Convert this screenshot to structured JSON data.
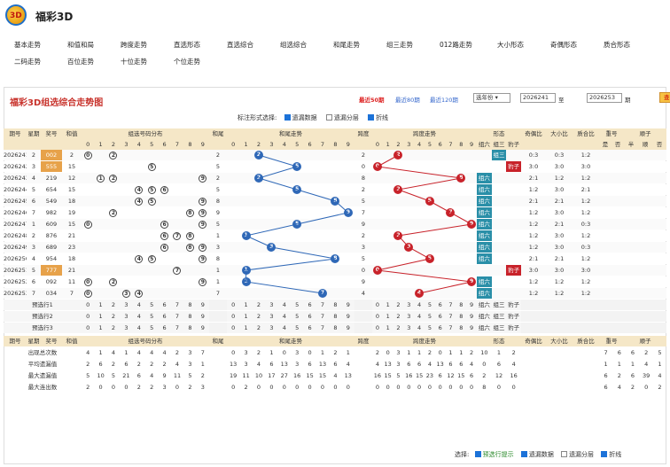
{
  "app": {
    "title": "福彩3D",
    "logo_text": "3D"
  },
  "nav": [
    {
      "label": "基本走势"
    },
    {
      "label": "和值和局"
    },
    {
      "label": "跨度走势"
    },
    {
      "label": "直选形态"
    },
    {
      "label": "直选综合"
    },
    {
      "label": "组选综合"
    },
    {
      "label": "和尾走势"
    },
    {
      "label": "组三走势"
    },
    {
      "label": "012路走势"
    },
    {
      "label": "大小形态"
    },
    {
      "label": "奇偶形态"
    },
    {
      "label": "质合形态"
    },
    {
      "label": "二码走势"
    },
    {
      "label": "百位走势"
    },
    {
      "label": "十位走势"
    },
    {
      "label": "个位走势"
    }
  ],
  "panel": {
    "title": "福彩3D组选综合走势图",
    "period_links": [
      "最近50期",
      "最近80期",
      "最近120期"
    ],
    "select_year": "选年份",
    "from_value": "2026241",
    "to_label": "至",
    "to_value": "2026253",
    "unit": "期",
    "query": "查看"
  },
  "options": {
    "label": "标注形式选择:",
    "items": [
      "遗漏数据",
      "遗漏分层",
      "折线"
    ],
    "checked": [
      true,
      false,
      true
    ]
  },
  "header_row": [
    "期号",
    "星期",
    "奖号",
    "和值",
    "组选号码分布",
    "和尾",
    "和尾走势",
    "跨度",
    "跨度走势",
    "形态",
    "奇偶比",
    "大小比",
    "质合比",
    "重号",
    "顺子"
  ],
  "subheader_digits": [
    "0",
    "1",
    "2",
    "3",
    "4",
    "5",
    "6",
    "7",
    "8",
    "9"
  ],
  "subheader_form": [
    "组六",
    "组三",
    "豹子"
  ],
  "subheader_tail": [
    "是",
    "否",
    "半",
    "顺",
    "否"
  ],
  "rows": [
    {
      "period": "2026241",
      "week": "2",
      "number": "002",
      "sum": "2",
      "tail": "2",
      "span": "2",
      "form": "组三",
      "oe": "0:3",
      "bs": "0:3",
      "pc": "1:2"
    },
    {
      "period": "2026242",
      "week": "3",
      "number": "555",
      "sum": "15",
      "tail": "5",
      "span": "0",
      "form": "豹子",
      "oe": "3:0",
      "bs": "3:0",
      "pc": "3:0"
    },
    {
      "period": "2026243",
      "week": "4",
      "number": "219",
      "sum": "12",
      "tail": "2",
      "span": "8",
      "form": "组六",
      "oe": "2:1",
      "bs": "1:2",
      "pc": "1:2"
    },
    {
      "period": "2026244",
      "week": "5",
      "number": "654",
      "sum": "15",
      "tail": "5",
      "span": "2",
      "form": "组六",
      "oe": "1:2",
      "bs": "3:0",
      "pc": "2:1"
    },
    {
      "period": "2026245",
      "week": "6",
      "number": "549",
      "sum": "18",
      "tail": "8",
      "span": "5",
      "form": "组六",
      "oe": "2:1",
      "bs": "2:1",
      "pc": "1:2"
    },
    {
      "period": "2026246",
      "week": "7",
      "number": "982",
      "sum": "19",
      "tail": "9",
      "span": "7",
      "form": "组六",
      "oe": "1:2",
      "bs": "3:0",
      "pc": "1:2"
    },
    {
      "period": "2026247",
      "week": "1",
      "number": "609",
      "sum": "15",
      "tail": "5",
      "span": "9",
      "form": "组六",
      "oe": "1:2",
      "bs": "2:1",
      "pc": "0:3"
    },
    {
      "period": "2026248",
      "week": "2",
      "number": "876",
      "sum": "21",
      "tail": "1",
      "span": "2",
      "form": "组六",
      "oe": "1:2",
      "bs": "3:0",
      "pc": "1:2"
    },
    {
      "period": "2026249",
      "week": "3",
      "number": "689",
      "sum": "23",
      "tail": "3",
      "span": "3",
      "form": "组六",
      "oe": "1:2",
      "bs": "3:0",
      "pc": "0:3"
    },
    {
      "period": "2026250",
      "week": "4",
      "number": "954",
      "sum": "18",
      "tail": "8",
      "span": "5",
      "form": "组六",
      "oe": "2:1",
      "bs": "2:1",
      "pc": "1:2"
    },
    {
      "period": "2026251",
      "week": "5",
      "number": "777",
      "sum": "21",
      "tail": "1",
      "span": "0",
      "form": "豹子",
      "oe": "3:0",
      "bs": "3:0",
      "pc": "3:0"
    },
    {
      "period": "2026252",
      "week": "6",
      "number": "092",
      "sum": "11",
      "tail": "1",
      "span": "9",
      "form": "组六",
      "oe": "1:2",
      "bs": "1:2",
      "pc": "1:2"
    },
    {
      "period": "2026253",
      "week": "7",
      "number": "034",
      "sum": "7",
      "tail": "7",
      "span": "4",
      "form": "组六",
      "oe": "1:2",
      "bs": "1:2",
      "pc": "1:2"
    }
  ],
  "preview_rows": [
    "预选行1",
    "预选行2",
    "预选行3"
  ],
  "stats_header": [
    "期号",
    "星期",
    "奖号",
    "和值",
    "组选号码分布",
    "和尾",
    "和尾走势",
    "跨度",
    "跨度走势",
    "形态",
    "奇偶比",
    "大小比",
    "质合比",
    "重号",
    "顺子"
  ],
  "stats": [
    {
      "label": "出现总次数",
      "dist": "4 1 4 1 4 4 4 2 3 7",
      "tail": "0 3 2 1 0 3 0 1 2 1",
      "span": "2 0 3 1 1 2 0 1 1 2",
      "form": "10 1 2",
      "rep": "7 6 6 2 5"
    },
    {
      "label": "平均遗漏值",
      "dist": "2 6 2 6 2 2 2 4 3 1",
      "tail": "13 3 4 6 13 3 6 13 6 4",
      "span": "4 13 3 6 6 4 13 6 6 4",
      "form": "0 6 4",
      "rep": "1 1 1 4 1"
    },
    {
      "label": "最大遗漏值",
      "dist": "5 10 5 21 6 4 9 11 5 2",
      "tail": "19 11 10 17 27 16 15 15 4 13",
      "span": "16 15 5 16 15 23 6 12 15 6",
      "form": "2 12 16",
      "rep": "6 2 6 39 4"
    },
    {
      "label": "最大连出数",
      "dist": "2 0 0 0 2 2 3 0 2 3",
      "tail": "0 2 0 0 0 0 0 0 0 0",
      "span": "0 0 0 0 0 0 0 0 0 0",
      "form": "8 0 0",
      "rep": "6 4 2 0 2"
    }
  ],
  "footer": {
    "label": "选择:",
    "items": [
      "预选行提示",
      "遗漏数据",
      "遗漏分层",
      "折线"
    ],
    "checked": [
      true,
      true,
      false,
      true
    ]
  }
}
